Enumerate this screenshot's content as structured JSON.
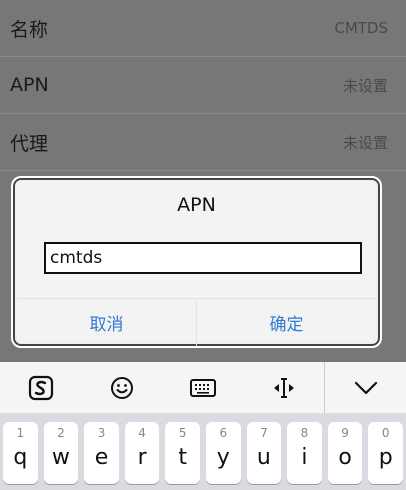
{
  "settings": {
    "rows": [
      {
        "label": "名称",
        "value": "CMTDS"
      },
      {
        "label": "APN",
        "value": "未设置"
      },
      {
        "label": "代理",
        "value": "未设置"
      }
    ]
  },
  "dialog": {
    "title": "APN",
    "input_value": "cmtds",
    "cancel_label": "取消",
    "confirm_label": "确定"
  },
  "keyboard": {
    "toolbar": [
      "sogou-logo-icon",
      "emoji-icon",
      "keyboard-icon",
      "cursor-move-icon",
      "collapse-keyboard-icon"
    ],
    "keys": [
      {
        "num": "1",
        "char": "q"
      },
      {
        "num": "2",
        "char": "w"
      },
      {
        "num": "3",
        "char": "e"
      },
      {
        "num": "4",
        "char": "r"
      },
      {
        "num": "5",
        "char": "t"
      },
      {
        "num": "6",
        "char": "y"
      },
      {
        "num": "7",
        "char": "u"
      },
      {
        "num": "8",
        "char": "i"
      },
      {
        "num": "9",
        "char": "o"
      },
      {
        "num": "0",
        "char": "p"
      }
    ]
  },
  "colors": {
    "accent": "#2f7ad6",
    "dim_background": "#777777"
  }
}
